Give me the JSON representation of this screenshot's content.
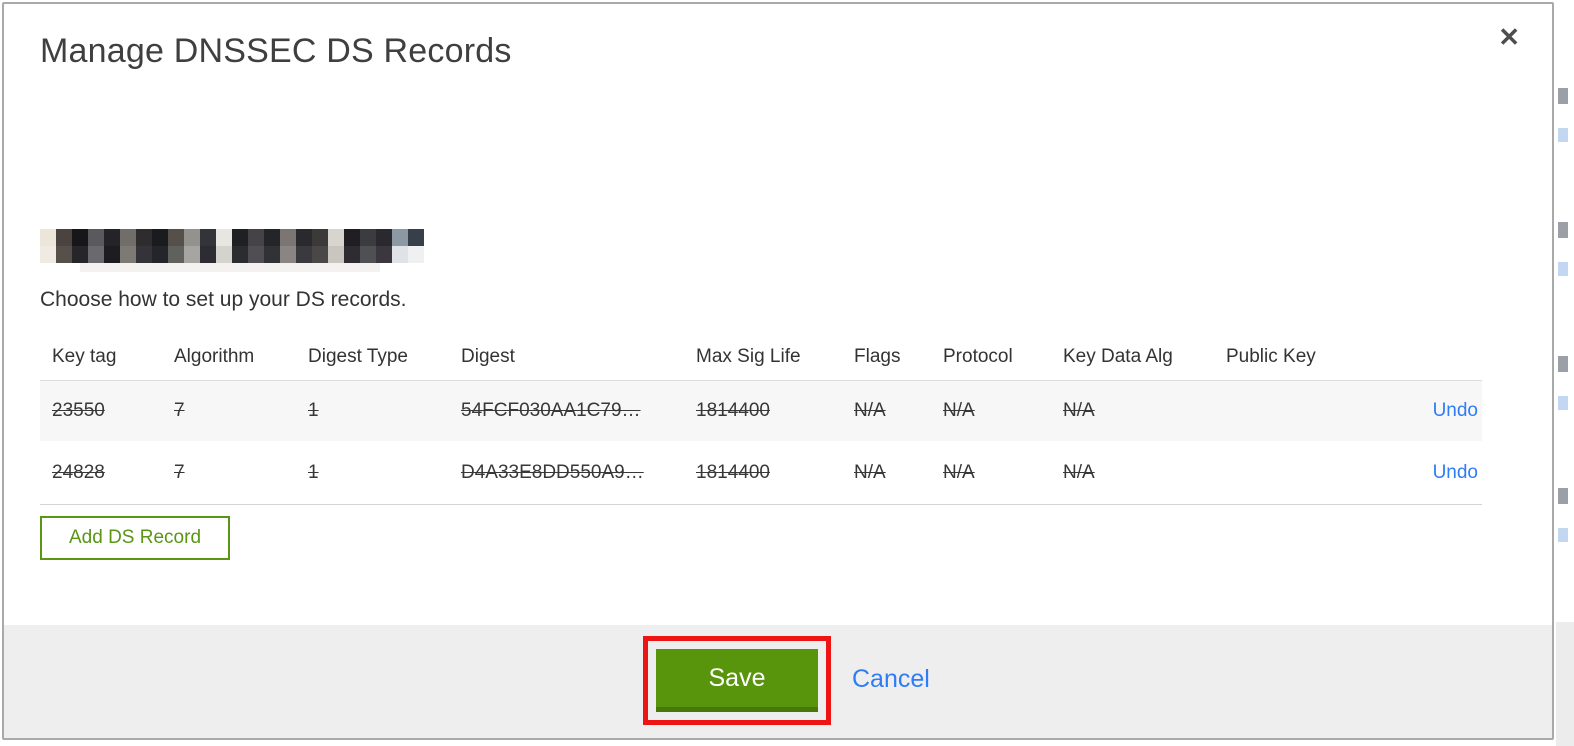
{
  "modal": {
    "title": "Manage DNSSEC DS Records",
    "close_label": "✕",
    "intro": "Choose how to set up your DS records.",
    "table": {
      "headers": [
        "Key tag",
        "Algorithm",
        "Digest Type",
        "Digest",
        "Max Sig Life",
        "Flags",
        "Protocol",
        "Key Data Alg",
        "Public Key"
      ],
      "rows": [
        {
          "key_tag": "23550",
          "algorithm": "7",
          "digest_type": "1",
          "digest": "54FCF030AA1C79…",
          "max_sig_life": "1814400",
          "flags": "N/A",
          "protocol": "N/A",
          "key_data_alg": "N/A",
          "public_key": "",
          "action_label": "Undo",
          "status": "marked-for-deletion"
        },
        {
          "key_tag": "24828",
          "algorithm": "7",
          "digest_type": "1",
          "digest": "D4A33E8DD550A9…",
          "max_sig_life": "1814400",
          "flags": "N/A",
          "protocol": "N/A",
          "key_data_alg": "N/A",
          "public_key": "",
          "action_label": "Undo",
          "status": "marked-for-deletion"
        }
      ]
    },
    "add_button_label": "Add DS Record",
    "footer": {
      "save_label": "Save",
      "cancel_label": "Cancel"
    }
  },
  "colors": {
    "accent_green": "#58940c",
    "green_border_dark": "#47790a",
    "link_blue": "#2e7cf6",
    "annotation_red": "#ee1414",
    "footer_bg": "#eeeeee",
    "alt_row_bg": "#f7f7f7",
    "modal_border": "#a9a9a9",
    "text_dark": "#383838"
  }
}
